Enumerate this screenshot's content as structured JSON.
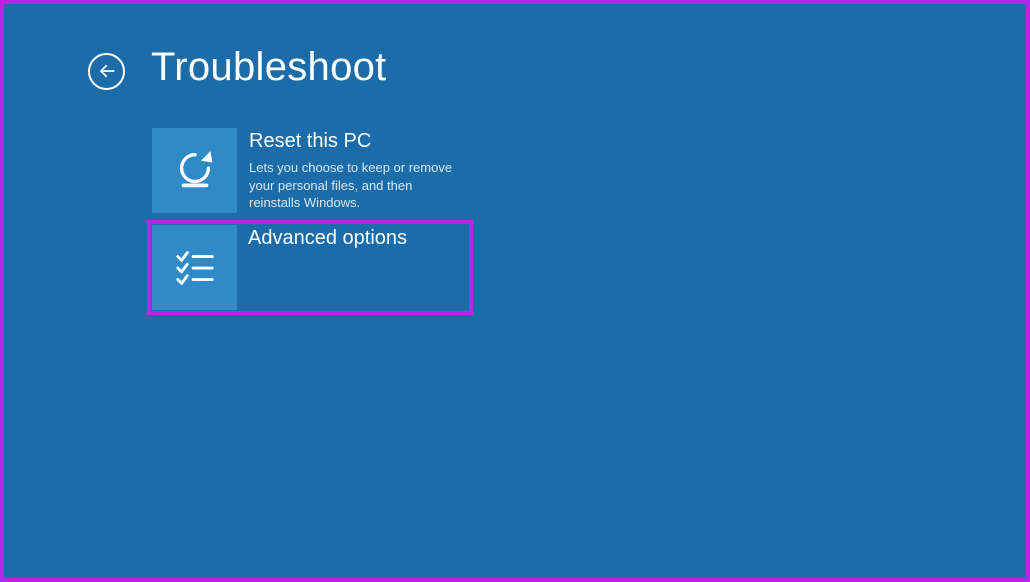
{
  "header": {
    "title": "Troubleshoot"
  },
  "options": [
    {
      "title": "Reset this PC",
      "description": "Lets you choose to keep or remove your personal files, and then reinstalls Windows."
    },
    {
      "title": "Advanced options",
      "description": ""
    }
  ]
}
